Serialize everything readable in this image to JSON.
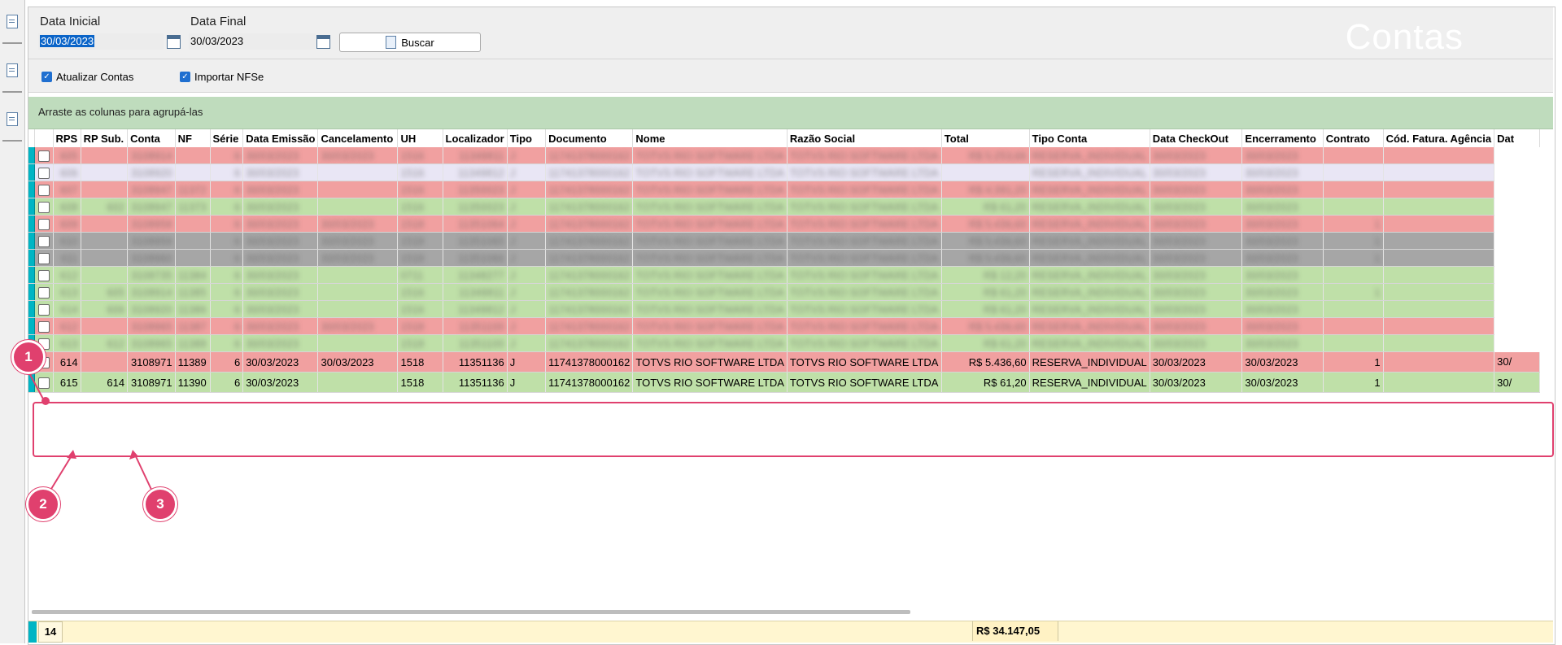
{
  "filters": {
    "initial_label": "Data Inicial",
    "initial_value": "30/03/2023",
    "final_label": "Data Final",
    "final_value": "30/03/2023",
    "search_label": "Buscar",
    "title": "Contas"
  },
  "options": {
    "update_accounts": "Atualizar Contas",
    "import_nfse": "Importar NFSe"
  },
  "grid": {
    "group_hint": "Arraste as colunas para agrupá-las",
    "columns": [
      "RPS",
      "RP Sub.",
      "Conta",
      "NF",
      "Série",
      "Data Emissão",
      "Cancelamento",
      "UH",
      "Localizador",
      "Tipo",
      "Documento",
      "Nome",
      "Razão Social",
      "Total",
      "Tipo Conta",
      "Data CheckOut",
      "Encerramento",
      "Contrato",
      "Cód. Fatura. Agência",
      "Dat"
    ],
    "blurred_rows": [
      {
        "color": "red",
        "cells": [
          "605",
          "",
          "3108914",
          "",
          "6",
          "30/03/2023",
          "30/03/2023",
          "1516",
          "11349811",
          "J",
          "11741378000162",
          "TOTVS RIO SOFTWARE LTDA",
          "TOTVS RIO SOFTWARE LTDA",
          "R$ 5.253,66",
          "RESERVA_INDIVIDUAL",
          "30/03/2023",
          "30/03/2023",
          "",
          ""
        ]
      },
      {
        "color": "lav",
        "cells": [
          "606",
          "",
          "3108920",
          "",
          "6",
          "30/03/2023",
          "",
          "1516",
          "11349812",
          "J",
          "11741378000162",
          "TOTVS RIO SOFTWARE LTDA",
          "TOTVS RIO SOFTWARE LTDA",
          "",
          "RESERVA_INDIVIDUAL",
          "30/03/2023",
          "30/03/2023",
          "",
          ""
        ]
      },
      {
        "color": "red",
        "cells": [
          "607",
          "",
          "3108947",
          "11372",
          "6",
          "30/03/2023",
          "",
          "1516",
          "11350023",
          "J",
          "11741378000162",
          "TOTVS RIO SOFTWARE LTDA",
          "TOTVS RIO SOFTWARE LTDA",
          "R$ 4.391,20",
          "RESERVA_INDIVIDUAL",
          "30/03/2023",
          "30/03/2023",
          "",
          ""
        ]
      },
      {
        "color": "grn",
        "cells": [
          "608",
          "602",
          "3108947",
          "11373",
          "6",
          "30/03/2023",
          "",
          "1516",
          "11350023",
          "J",
          "11741378000162",
          "TOTVS RIO SOFTWARE LTDA",
          "TOTVS RIO SOFTWARE LTDA",
          "R$ 61,20",
          "RESERVA_INDIVIDUAL",
          "30/03/2023",
          "30/03/2023",
          "",
          ""
        ]
      },
      {
        "color": "red",
        "cells": [
          "609",
          "",
          "3108958",
          "",
          "6",
          "30/03/2023",
          "30/03/2023",
          "1518",
          "11351064",
          "J",
          "11741378000162",
          "TOTVS RIO SOFTWARE LTDA",
          "TOTVS RIO SOFTWARE LTDA",
          "R$ 5.436,60",
          "RESERVA_INDIVIDUAL",
          "30/03/2023",
          "30/03/2023",
          "1",
          ""
        ]
      },
      {
        "color": "gry",
        "cells": [
          "610",
          "",
          "3108959",
          "",
          "6",
          "30/03/2023",
          "30/03/2023",
          "1518",
          "11351065",
          "J",
          "11741378000162",
          "TOTVS RIO SOFTWARE LTDA",
          "TOTVS RIO SOFTWARE LTDA",
          "R$ 5.436,60",
          "RESERVA_INDIVIDUAL",
          "30/03/2023",
          "30/03/2023",
          "1",
          ""
        ]
      },
      {
        "color": "gry",
        "cells": [
          "611",
          "",
          "3108960",
          "",
          "6",
          "30/03/2023",
          "30/03/2023",
          "1518",
          "11351066",
          "J",
          "11741378000162",
          "TOTVS RIO SOFTWARE LTDA",
          "TOTVS RIO SOFTWARE LTDA",
          "R$ 5.436,60",
          "RESERVA_INDIVIDUAL",
          "30/03/2023",
          "30/03/2023",
          "1",
          ""
        ]
      },
      {
        "color": "grn",
        "cells": [
          "612",
          "",
          "3108735",
          "11384",
          "6",
          "30/03/2023",
          "",
          "0711",
          "11348277",
          "J",
          "11741378000162",
          "TOTVS RIO SOFTWARE LTDA",
          "TOTVS RIO SOFTWARE LTDA",
          "R$ 12,20",
          "RESERVA_INDIVIDUAL",
          "30/03/2023",
          "30/03/2023",
          "",
          ""
        ]
      },
      {
        "color": "grn",
        "cells": [
          "613",
          "605",
          "3108914",
          "11385",
          "6",
          "30/03/2023",
          "",
          "1516",
          "11349811",
          "J",
          "11741378000162",
          "TOTVS RIO SOFTWARE LTDA",
          "TOTVS RIO SOFTWARE LTDA",
          "R$ 61,20",
          "RESERVA_INDIVIDUAL",
          "30/03/2023",
          "30/03/2023",
          "1",
          ""
        ]
      },
      {
        "color": "grn",
        "cells": [
          "614",
          "606",
          "3108920",
          "11386",
          "6",
          "30/03/2023",
          "",
          "1516",
          "11349812",
          "J",
          "11741378000162",
          "TOTVS RIO SOFTWARE LTDA",
          "TOTVS RIO SOFTWARE LTDA",
          "R$ 61,20",
          "RESERVA_INDIVIDUAL",
          "30/03/2023",
          "30/03/2023",
          "",
          ""
        ]
      },
      {
        "color": "red",
        "cells": [
          "612",
          "",
          "3108965",
          "11387",
          "6",
          "30/03/2023",
          "30/03/2023",
          "1518",
          "11351100",
          "J",
          "11741378000162",
          "TOTVS RIO SOFTWARE LTDA",
          "TOTVS RIO SOFTWARE LTDA",
          "R$ 5.436,60",
          "RESERVA_INDIVIDUAL",
          "30/03/2023",
          "30/03/2023",
          "",
          ""
        ]
      },
      {
        "color": "grn",
        "cells": [
          "613",
          "612",
          "3108965",
          "11388",
          "6",
          "30/03/2023",
          "",
          "1518",
          "11351100",
          "J",
          "11741378000162",
          "TOTVS RIO SOFTWARE LTDA",
          "TOTVS RIO SOFTWARE LTDA",
          "R$ 61,20",
          "RESERVA_INDIVIDUAL",
          "30/03/2023",
          "30/03/2023",
          "",
          ""
        ]
      }
    ],
    "rows": [
      {
        "color": "red",
        "cells": [
          "614",
          "",
          "3108971",
          "11389",
          "6",
          "30/03/2023",
          "30/03/2023",
          "1518",
          "11351136",
          "J",
          "11741378000162",
          "TOTVS RIO SOFTWARE LTDA",
          "TOTVS RIO SOFTWARE LTDA",
          "R$ 5.436,60",
          "RESERVA_INDIVIDUAL",
          "30/03/2023",
          "30/03/2023",
          "1",
          "",
          "30/"
        ]
      },
      {
        "color": "grn",
        "cells": [
          "615",
          "614",
          "3108971",
          "11390",
          "6",
          "30/03/2023",
          "",
          "1518",
          "11351136",
          "J",
          "11741378000162",
          "TOTVS RIO SOFTWARE LTDA",
          "TOTVS RIO SOFTWARE LTDA",
          "R$ 61,20",
          "RESERVA_INDIVIDUAL",
          "30/03/2023",
          "30/03/2023",
          "1",
          "",
          "30/"
        ]
      }
    ],
    "footer_count": "14",
    "footer_total": "R$ 34.147,05"
  },
  "callouts": [
    "1",
    "2",
    "3"
  ],
  "colors": {
    "accent_cyan": "#00b5c4",
    "row_red": "#f1a0a0",
    "row_green": "#bfe0a8",
    "callout_pink": "#e0406e"
  },
  "icons": {
    "sidebar": [
      "report-icon",
      "document-icon",
      "document-icon"
    ],
    "calendar": "calendar-icon",
    "search": "search-document-icon",
    "check": "checkmark-icon"
  }
}
